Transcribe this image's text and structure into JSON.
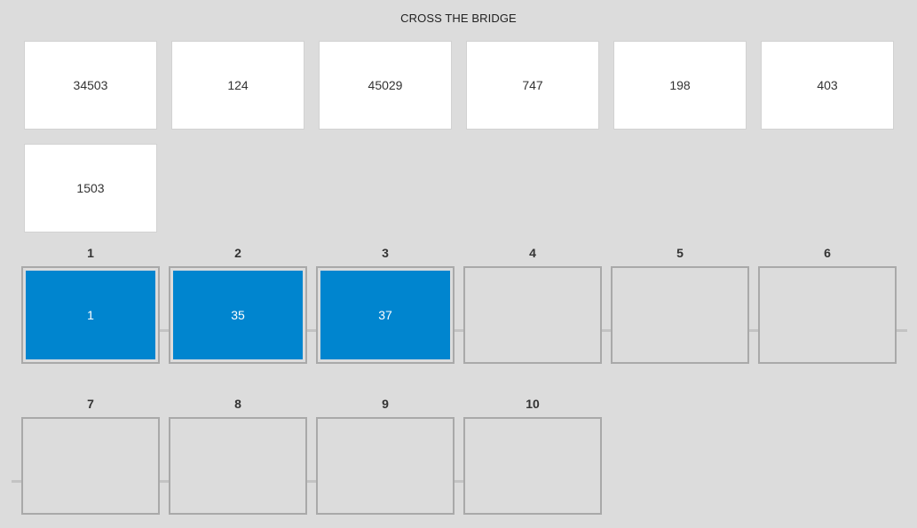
{
  "game": {
    "title": "CROSS THE BRIDGE"
  },
  "tiles": [
    "34503",
    "124",
    "45029",
    "747",
    "198",
    "403",
    "1503"
  ],
  "slots": [
    {
      "label": "1",
      "value": "1"
    },
    {
      "label": "2",
      "value": "35"
    },
    {
      "label": "3",
      "value": "37"
    },
    {
      "label": "4",
      "value": ""
    },
    {
      "label": "5",
      "value": ""
    },
    {
      "label": "6",
      "value": ""
    },
    {
      "label": "7",
      "value": ""
    },
    {
      "label": "8",
      "value": ""
    },
    {
      "label": "9",
      "value": ""
    },
    {
      "label": "10",
      "value": ""
    }
  ],
  "colors": {
    "background": "#dcdcdc",
    "tile": "#ffffff",
    "placed": "#0085cf",
    "slot_border": "#a9a9a9"
  }
}
